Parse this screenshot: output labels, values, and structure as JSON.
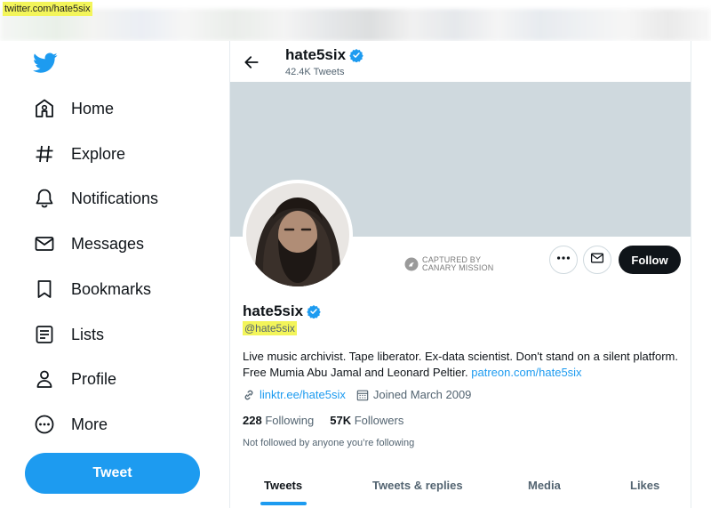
{
  "browser": {
    "url": "twitter.com/hate5six"
  },
  "nav": {
    "items": [
      {
        "label": "Home",
        "icon": "home-icon"
      },
      {
        "label": "Explore",
        "icon": "hashtag-icon"
      },
      {
        "label": "Notifications",
        "icon": "bell-icon"
      },
      {
        "label": "Messages",
        "icon": "envelope-icon"
      },
      {
        "label": "Bookmarks",
        "icon": "bookmark-icon"
      },
      {
        "label": "Lists",
        "icon": "list-icon"
      },
      {
        "label": "Profile",
        "icon": "person-icon"
      },
      {
        "label": "More",
        "icon": "more-circle-icon"
      }
    ],
    "tweet_label": "Tweet"
  },
  "header": {
    "name": "hate5six",
    "tweet_count": "42.4K Tweets"
  },
  "profile": {
    "name": "hate5six",
    "handle": "@hate5six",
    "bio_text": "Live music archivist. Tape liberator. Ex-data scientist. Don't stand on a silent platform. Free Mumia Abu Jamal and Leonard Peltier. ",
    "bio_link": "patreon.com/hate5six",
    "website": "linktr.ee/hate5six",
    "joined": "Joined March 2009",
    "following_count": "228",
    "following_label": "Following",
    "followers_count": "57K",
    "followers_label": "Followers",
    "not_followed": "Not followed by anyone you’re following",
    "follow_label": "Follow"
  },
  "stamp": {
    "line1": "CAPTURED BY",
    "line2": "CANARY MISSION"
  },
  "tabs": [
    {
      "label": "Tweets",
      "active": true
    },
    {
      "label": "Tweets & replies",
      "active": false
    },
    {
      "label": "Media",
      "active": false
    },
    {
      "label": "Likes",
      "active": false
    }
  ],
  "colors": {
    "accent": "#1d9bf0",
    "highlight": "#f3f55a",
    "banner": "#cfd9de",
    "follow_bg": "#0f1419"
  }
}
